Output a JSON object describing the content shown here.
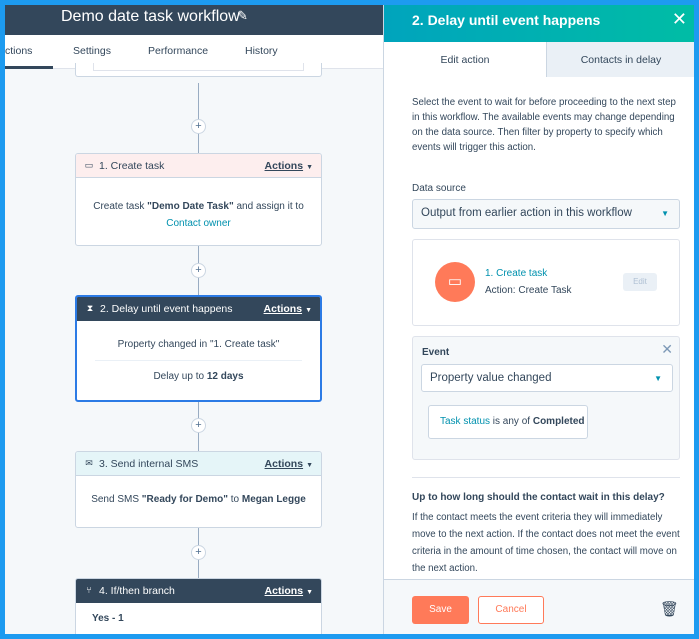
{
  "workflow": {
    "title": "Demo date task workflow",
    "tabs": [
      "ctions",
      "Settings",
      "Performance",
      "History"
    ]
  },
  "cards": {
    "create_task": {
      "label": "1. Create task",
      "actions": "Actions",
      "body_prefix": "Create task ",
      "body_bold": "\"Demo Date Task\"",
      "body_suffix": " and assign it to",
      "body_link": "Contact owner"
    },
    "delay": {
      "label": "2. Delay until event happens",
      "actions": "Actions",
      "line1": "Property changed in \"1. Create task\"",
      "line2_prefix": "Delay up to ",
      "line2_bold": "12 days"
    },
    "sms": {
      "label": "3. Send internal SMS",
      "actions": "Actions",
      "body_prefix": "Send SMS ",
      "body_bold": "\"Ready for Demo\"",
      "body_suffix": " to ",
      "body_bold2": "Megan Legge"
    },
    "branch": {
      "label": "4. If/then branch",
      "actions": "Actions",
      "body": "Yes - 1"
    }
  },
  "panel": {
    "title": "2. Delay until event happens",
    "tabs": {
      "edit": "Edit action",
      "contacts": "Contacts in delay"
    },
    "description": "Select the event to wait for before proceeding to the next step in this workflow. The available events may change depending on the data source. Then filter by property to specify which events will trigger this action.",
    "data_source_label": "Data source",
    "data_source_value": "Output from earlier action in this workflow",
    "source_action_name": "1. Create task",
    "source_action_sub": "Action: Create Task",
    "source_edit": "Edit",
    "event_label": "Event",
    "event_value": "Property value changed",
    "filter_prop": "Task status",
    "filter_mid": " is any of ",
    "filter_val": "Completed",
    "question": "Up to how long should the contact wait in this delay?",
    "question_desc": "If the contact meets the event criteria they will immediately move to the next action. If the contact does not meet the event criteria in the amount of time chosen, the contact will move on the next action.",
    "save": "Save",
    "cancel": "Cancel"
  },
  "colors": {
    "accent": "#ff7a59",
    "teal": "#00a4bd",
    "dark": "#33475b",
    "link": "#0091ae"
  },
  "icons": [
    "edit-icon",
    "plus-icon",
    "task-icon",
    "hourglass-icon",
    "sms-icon",
    "branch-icon",
    "chevron-down-icon",
    "close-icon",
    "trash-icon"
  ]
}
